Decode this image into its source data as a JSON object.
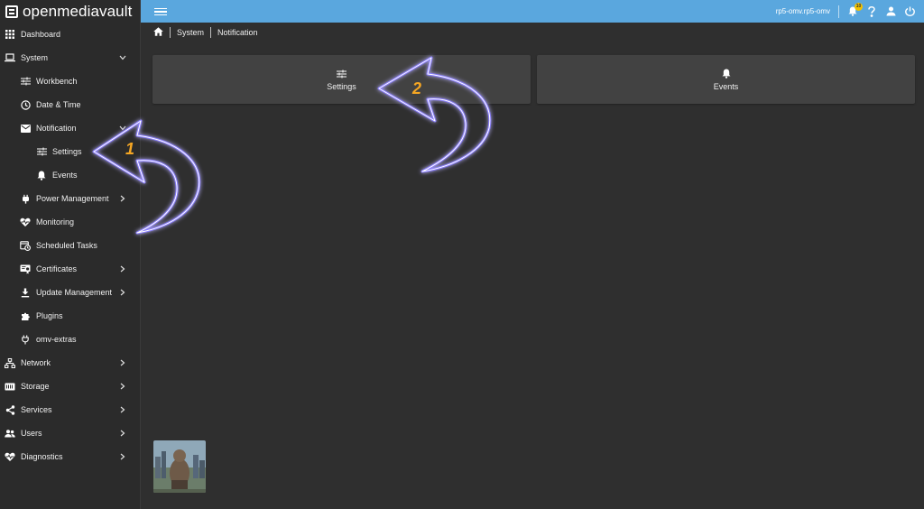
{
  "app": {
    "logo_text": "openmediavault"
  },
  "sidebar": {
    "items": [
      {
        "label": "Dashboard",
        "icon": "grid-icon"
      },
      {
        "label": "System",
        "icon": "laptop-icon",
        "expanded": true
      },
      {
        "label": "Workbench",
        "icon": "sliders-icon"
      },
      {
        "label": "Date & Time",
        "icon": "clock-icon"
      },
      {
        "label": "Notification",
        "icon": "mail-icon",
        "expanded": true
      },
      {
        "label": "Settings",
        "icon": "sliders-icon"
      },
      {
        "label": "Events",
        "icon": "bell-icon"
      },
      {
        "label": "Power Management",
        "icon": "power-plug-icon"
      },
      {
        "label": "Monitoring",
        "icon": "heart-pulse-icon"
      },
      {
        "label": "Scheduled Tasks",
        "icon": "calendar-clock-icon"
      },
      {
        "label": "Certificates",
        "icon": "certificate-icon"
      },
      {
        "label": "Update Management",
        "icon": "download-icon"
      },
      {
        "label": "Plugins",
        "icon": "puzzle-icon"
      },
      {
        "label": "omv-extras",
        "icon": "plug-icon"
      },
      {
        "label": "Network",
        "icon": "network-icon"
      },
      {
        "label": "Storage",
        "icon": "storage-icon"
      },
      {
        "label": "Services",
        "icon": "share-icon"
      },
      {
        "label": "Users",
        "icon": "users-icon"
      },
      {
        "label": "Diagnostics",
        "icon": "heart-pulse-icon"
      }
    ]
  },
  "topbar": {
    "hostname": "rp5-omv.rp5-omv",
    "notification_count": "10",
    "colors": {
      "bar": "#5aa7de",
      "badge": "#f2c200"
    }
  },
  "breadcrumb": {
    "system": "System",
    "notification": "Notification"
  },
  "cards": {
    "settings": {
      "label": "Settings",
      "icon": "sliders-icon"
    },
    "events": {
      "label": "Events",
      "icon": "bell-icon"
    }
  },
  "annotations": {
    "step1": "1",
    "step2": "2",
    "arrow_color": "#8a7dff",
    "number_color": "#f5a623"
  }
}
